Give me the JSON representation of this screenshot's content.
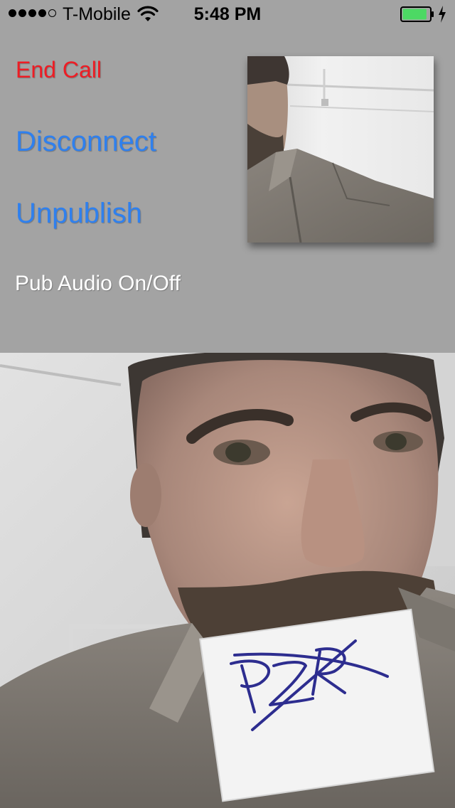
{
  "status_bar": {
    "carrier": "T-Mobile",
    "time": "5:48 PM",
    "signal_bars_filled": 4,
    "signal_bars_total": 5,
    "battery_level": 0.9,
    "icons": [
      "signal-dots-icon",
      "wifi-icon",
      "battery-icon",
      "charging-bolt-icon"
    ]
  },
  "controls": {
    "end_call": "End Call",
    "disconnect": "Disconnect",
    "unpublish": "Unpublish",
    "pub_audio": "Pub Audio On/Off"
  },
  "colors": {
    "background": "#a3a3a3",
    "end_call": "#ee1c24",
    "link_blue": "#2f80ee",
    "pub_audio": "#ffffff",
    "battery_fill": "#4cd964"
  },
  "subscriber": {
    "note_text": "PZR"
  }
}
